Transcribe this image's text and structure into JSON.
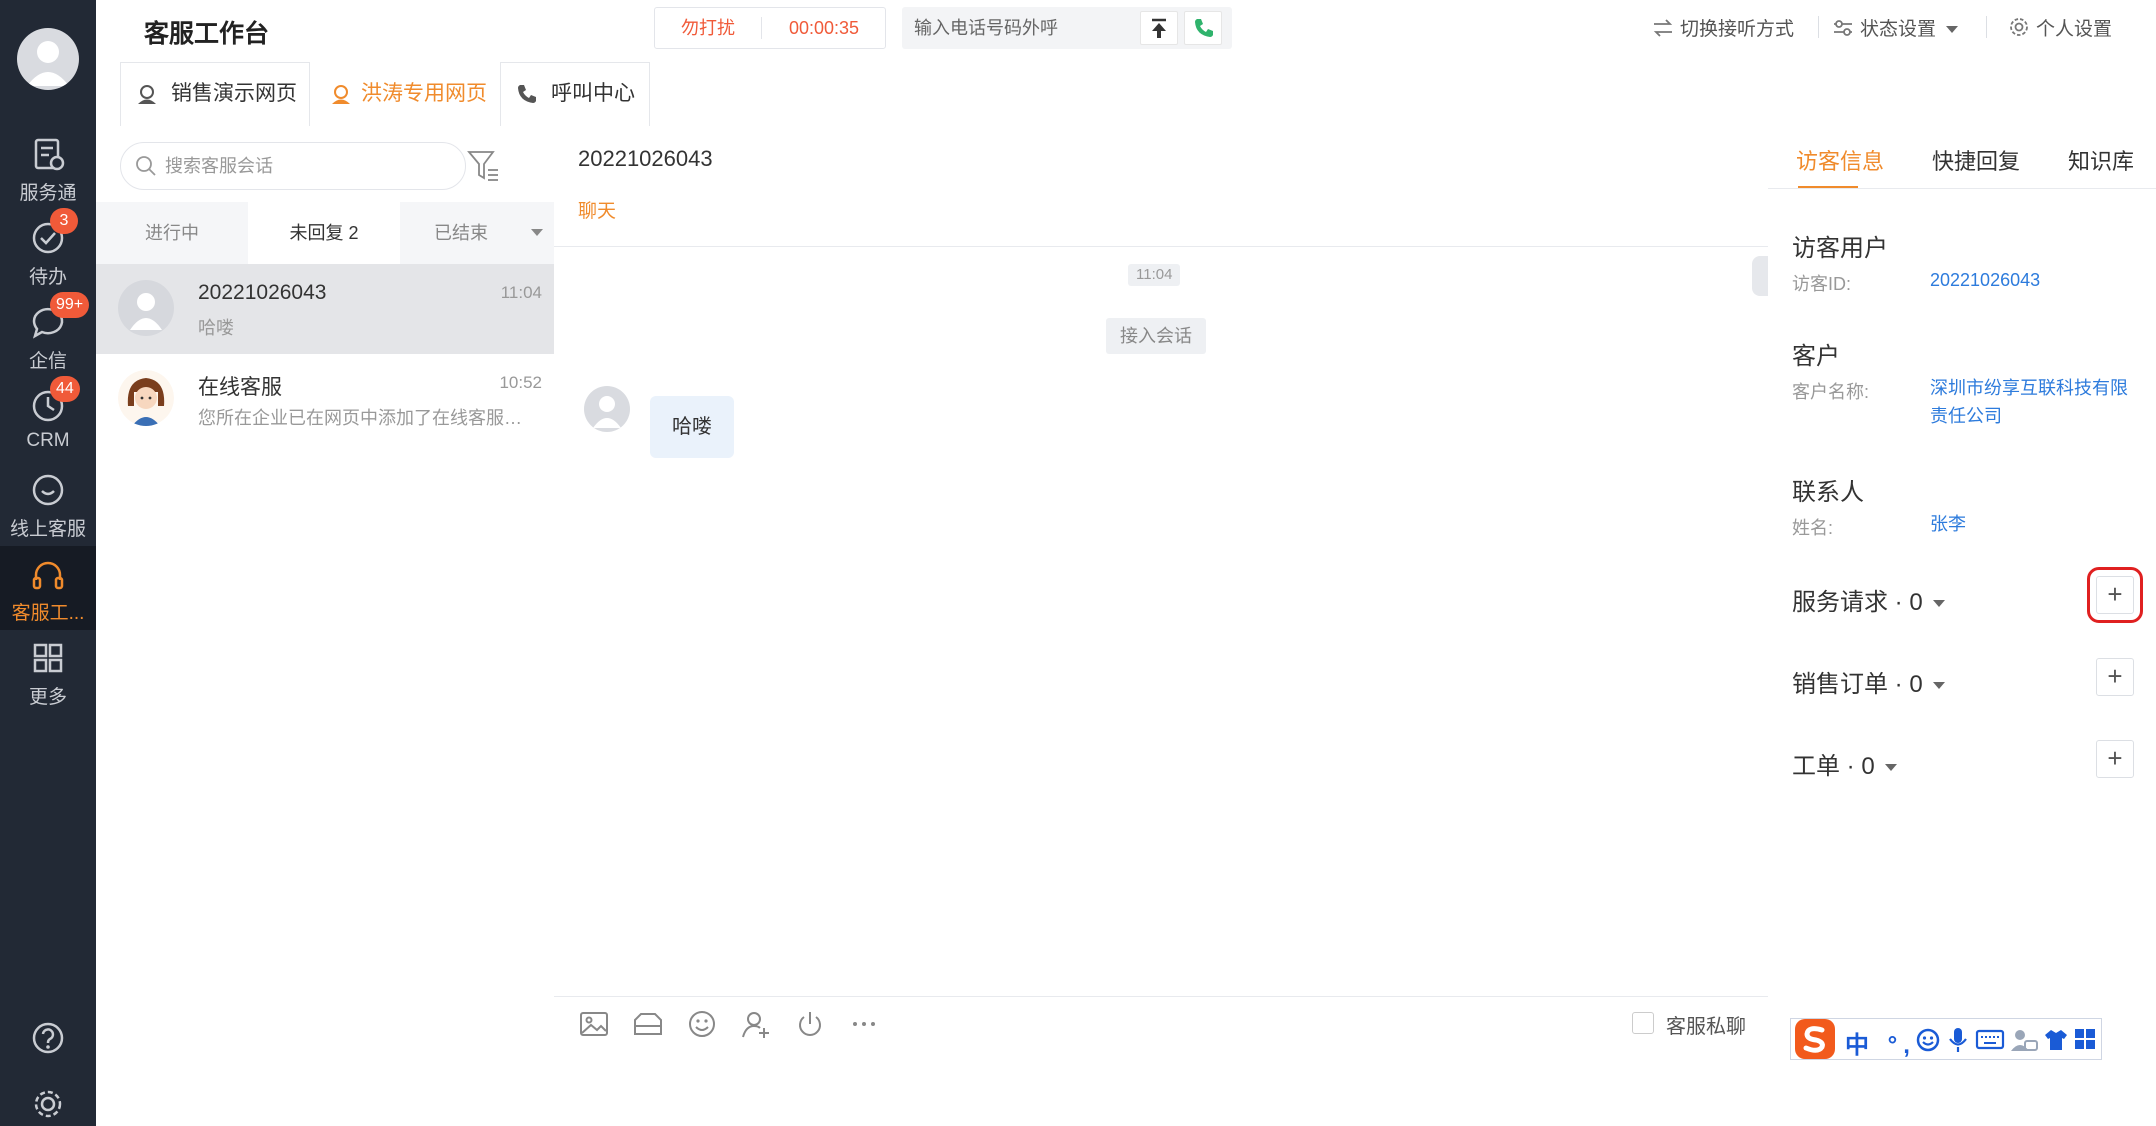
{
  "sidebar": {
    "items": [
      {
        "label": "服务通",
        "badge": ""
      },
      {
        "label": "待办",
        "badge": "3"
      },
      {
        "label": "企信",
        "badge": "99+"
      },
      {
        "label": "CRM",
        "badge": "44"
      },
      {
        "label": "线上客服",
        "badge": ""
      },
      {
        "label": "客服工...",
        "badge": ""
      },
      {
        "label": "更多",
        "badge": ""
      }
    ],
    "active_index": 5
  },
  "header": {
    "title": "客服工作台",
    "dnd_label": "勿打扰",
    "timer": "00:00:35",
    "dial_placeholder": "输入电话号码外呼",
    "switch_answer": "切换接听方式",
    "status_settings": "状态设置",
    "personal_settings": "个人设置"
  },
  "tabs": [
    {
      "label": "销售演示网页",
      "active": false
    },
    {
      "label": "洪涛专用网页",
      "active": true
    },
    {
      "label": "呼叫中心",
      "active": false
    }
  ],
  "conversation_list": {
    "search_placeholder": "搜索客服会话",
    "filters": [
      {
        "label": "进行中",
        "active": false
      },
      {
        "label": "未回复 2",
        "active": true
      },
      {
        "label": "已结束",
        "active": false
      }
    ],
    "items": [
      {
        "name": "20221026043",
        "time": "11:04",
        "preview": "哈喽",
        "selected": true
      },
      {
        "name": "在线客服",
        "time": "10:52",
        "preview": "您所在企业已在网页中添加了在线客服插件",
        "selected": false
      }
    ]
  },
  "chat": {
    "title": "20221026043",
    "subtab": "聊天",
    "time_divider": "11:04",
    "system_message": "接入会话",
    "messages": [
      {
        "text": "哈喽"
      }
    ],
    "toolbar_icons": [
      "image-icon",
      "folder-icon",
      "emoji-icon",
      "transfer-icon",
      "end-session-icon",
      "more-icon"
    ],
    "private_chat_label": "客服私聊"
  },
  "right_panel": {
    "tabs": [
      {
        "label": "访客信息",
        "active": true
      },
      {
        "label": "快捷回复",
        "active": false
      },
      {
        "label": "知识库",
        "active": false
      }
    ],
    "visitor": {
      "section": "访客用户",
      "key": "访客ID:",
      "value": "20221026043"
    },
    "customer": {
      "section": "客户",
      "key": "客户名称:",
      "value": "深圳市纷享互联科技有限责任公司"
    },
    "contact": {
      "section": "联系人",
      "key": "姓名:",
      "value": "张李"
    },
    "sections": [
      {
        "label": "服务请求 · 0"
      },
      {
        "label": "销售订单 · 0"
      },
      {
        "label": "工单 · 0"
      }
    ],
    "plus_label": "+"
  },
  "ime": {
    "chars": "中 °,"
  },
  "colors": {
    "accent": "#f08b2c",
    "sidebar_bg": "#222935",
    "link": "#2d7bdc",
    "badge": "#f05a39",
    "highlight": "#e02020"
  }
}
